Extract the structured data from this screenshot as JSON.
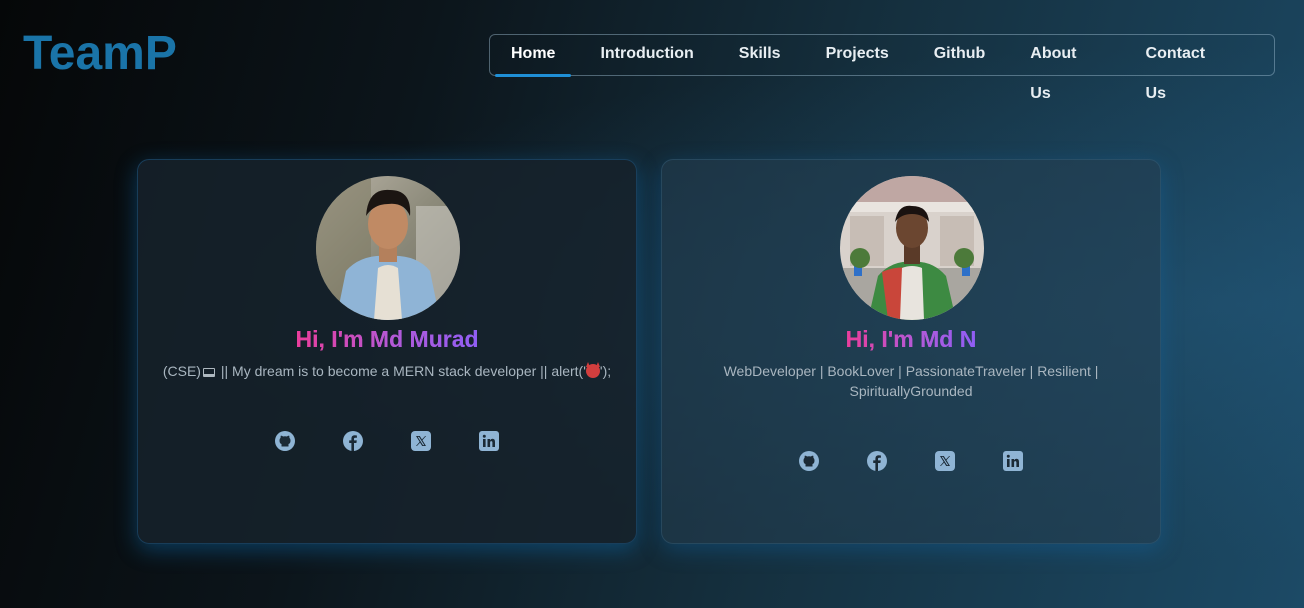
{
  "brand": {
    "logo_text": "TeamP",
    "accent_color": "#1a74a8"
  },
  "nav": {
    "items": [
      {
        "label": "Home",
        "active": true
      },
      {
        "label": "Introduction",
        "active": false
      },
      {
        "label": "Skills",
        "active": false
      },
      {
        "label": "Projects",
        "active": false
      },
      {
        "label": "Github",
        "active": false
      },
      {
        "label": "About Us",
        "active": false
      },
      {
        "label": "Contact Us",
        "active": false
      }
    ],
    "active_underline_color": "#1f8fd6"
  },
  "team": [
    {
      "greeting": "Hi, I'm Md Murad",
      "bio_prefix": "(CSE)",
      "bio_middle": " || My dream is to become a MERN stack developer || alert('",
      "bio_suffix": "');",
      "bio_emojis": [
        "laptop-emoji",
        "devil-emoji"
      ],
      "socials": [
        "github-icon",
        "facebook-icon",
        "x-icon",
        "linkedin-icon"
      ]
    },
    {
      "greeting": "Hi, I'm Md N",
      "bio": "WebDeveloper | BookLover | PassionateTraveler | Resilient | SpirituallyGrounded",
      "socials": [
        "github-icon",
        "facebook-icon",
        "x-icon",
        "linkedin-icon"
      ]
    }
  ],
  "colors": {
    "greeting_gradient_start": "#ec3d9a",
    "greeting_gradient_end": "#8f5ef5",
    "social_icon": "#8fb4d4",
    "bio_text": "#a9b6c0"
  }
}
